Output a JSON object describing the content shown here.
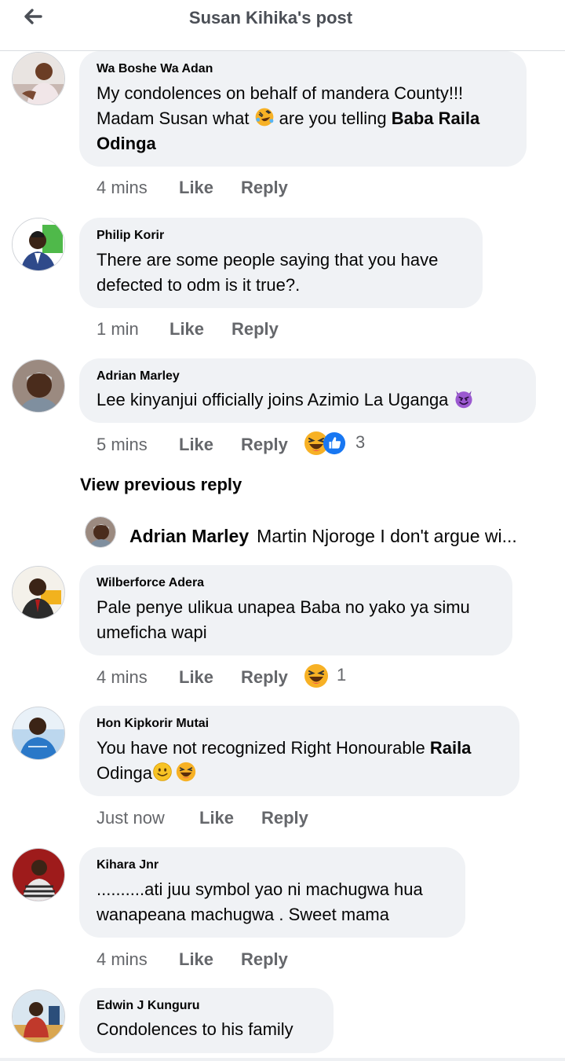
{
  "header": {
    "title": "Susan Kihika's post"
  },
  "comments": [
    {
      "name": "Wa Boshe Wa Adan",
      "text_1": "My condolences on behalf of mandera County!!!",
      "text_2a": "Madam Susan what ",
      "text_2b": " are you telling ",
      "text_2c": "Baba Raila",
      "text_3": "Odinga",
      "time": "4 mins",
      "like": "Like",
      "reply": "Reply"
    },
    {
      "name": "Philip Korir",
      "text_1": "There are some people saying that you have",
      "text_2": "defected to odm is it true?.",
      "time": "1 min",
      "like": "Like",
      "reply": "Reply"
    },
    {
      "name": "Adrian Marley",
      "text_1": " Lee kinyanjui officially joins Azimio La Uganga ",
      "time": "5 mins",
      "like": "Like",
      "reply": "Reply",
      "reaction_count": "3"
    },
    {
      "name": "Wilberforce Adera",
      "text_1": "Pale penye ulikua unapea Baba no yako ya simu",
      "text_2": "umeficha wapi",
      "time": "4 mins",
      "like": "Like",
      "reply": "Reply",
      "reaction_count": "1"
    },
    {
      "name": "Hon Kipkorir Mutai",
      "text_1a": "You have not recognized Right Honourable ",
      "text_1b": "Raila",
      "text_2": "Odinga",
      "time": "Just now",
      "like": "Like",
      "reply": "Reply"
    },
    {
      "name": "Kihara Jnr",
      "text_1": "..........ati juu symbol yao ni machugwa hua",
      "text_2": "wanapeana machugwa . Sweet mama",
      "time": "4 mins",
      "like": "Like",
      "reply": "Reply"
    },
    {
      "name": "Edwin J Kunguru",
      "text_1": "Condolences to his family"
    }
  ],
  "view_previous": "View previous reply",
  "reply_preview": {
    "name": "Adrian Marley",
    "text": "Martin Njoroge I don't argue wi..."
  },
  "icons": {
    "back": "back-arrow-icon",
    "laugh": "laughing-emoji-icon",
    "devil": "smiling-devil-emoji-icon",
    "smile": "smiling-face-emoji-icon",
    "like": "like-thumb-icon"
  },
  "colors": {
    "bubble": "#f0f2f5",
    "meta": "#65676b",
    "like_blue": "#1877f2",
    "laugh_yellow": "#f7b125"
  }
}
